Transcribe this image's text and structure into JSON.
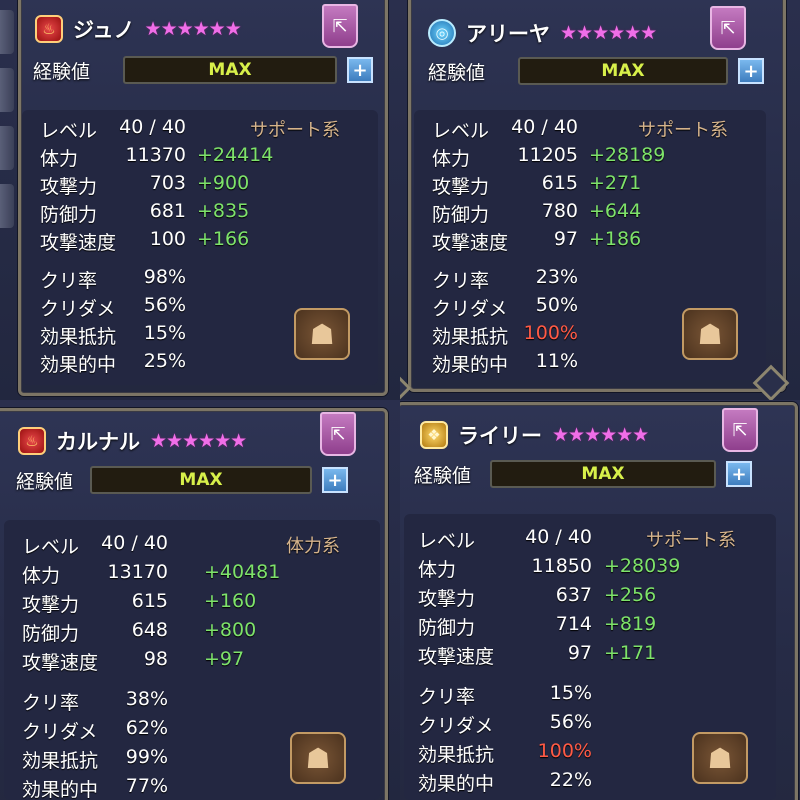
{
  "panels": [
    {
      "name": "ジュノ",
      "element": "fire",
      "element_icon": "flame",
      "stars": "★★★★★★",
      "exp_label": "経験値",
      "exp_value": "MAX",
      "category": "サポート系",
      "stats": [
        {
          "label": "レベル",
          "value": "40 / 40",
          "bonus": ""
        },
        {
          "label": "体力",
          "value": "11370",
          "bonus": "+24414"
        },
        {
          "label": "攻撃力",
          "value": "703",
          "bonus": "+900"
        },
        {
          "label": "防御力",
          "value": "681",
          "bonus": "+835"
        },
        {
          "label": "攻撃速度",
          "value": "100",
          "bonus": "+166"
        },
        {
          "label": "クリ率",
          "value": "98%",
          "bonus": ""
        },
        {
          "label": "クリダメ",
          "value": "56%",
          "bonus": ""
        },
        {
          "label": "効果抵抗",
          "value": "15%",
          "bonus": ""
        },
        {
          "label": "効果的中",
          "value": "25%",
          "bonus": ""
        }
      ]
    },
    {
      "name": "アリーヤ",
      "element": "water",
      "element_icon": "swirl",
      "stars": "★★★★★★",
      "exp_label": "経験値",
      "exp_value": "MAX",
      "category": "サポート系",
      "stats": [
        {
          "label": "レベル",
          "value": "40 / 40",
          "bonus": ""
        },
        {
          "label": "体力",
          "value": "11205",
          "bonus": "+28189"
        },
        {
          "label": "攻撃力",
          "value": "615",
          "bonus": "+271"
        },
        {
          "label": "防御力",
          "value": "780",
          "bonus": "+644"
        },
        {
          "label": "攻撃速度",
          "value": "97",
          "bonus": "+186"
        },
        {
          "label": "クリ率",
          "value": "23%",
          "bonus": ""
        },
        {
          "label": "クリダメ",
          "value": "50%",
          "bonus": ""
        },
        {
          "label": "効果抵抗",
          "value": "100%",
          "bonus": "",
          "highlight": "#ff5a45"
        },
        {
          "label": "効果的中",
          "value": "11%",
          "bonus": ""
        }
      ]
    },
    {
      "name": "カルナル",
      "element": "fire",
      "element_icon": "flame",
      "stars": "★★★★★★",
      "exp_label": "経験値",
      "exp_value": "MAX",
      "category": "体力系",
      "stats": [
        {
          "label": "レベル",
          "value": "40 / 40",
          "bonus": ""
        },
        {
          "label": "体力",
          "value": "13170",
          "bonus": "+40481"
        },
        {
          "label": "攻撃力",
          "value": "615",
          "bonus": "+160"
        },
        {
          "label": "防御力",
          "value": "648",
          "bonus": "+800"
        },
        {
          "label": "攻撃速度",
          "value": "98",
          "bonus": "+97"
        },
        {
          "label": "クリ率",
          "value": "38%",
          "bonus": ""
        },
        {
          "label": "クリダメ",
          "value": "62%",
          "bonus": ""
        },
        {
          "label": "効果抵抗",
          "value": "99%",
          "bonus": ""
        },
        {
          "label": "効果的中",
          "value": "77%",
          "bonus": ""
        }
      ]
    },
    {
      "name": "ライリー",
      "element": "wind",
      "element_icon": "gust",
      "stars": "★★★★★★",
      "exp_label": "経験値",
      "exp_value": "MAX",
      "category": "サポート系",
      "stats": [
        {
          "label": "レベル",
          "value": "40 / 40",
          "bonus": ""
        },
        {
          "label": "体力",
          "value": "11850",
          "bonus": "+28039"
        },
        {
          "label": "攻撃力",
          "value": "637",
          "bonus": "+256"
        },
        {
          "label": "防御力",
          "value": "714",
          "bonus": "+819"
        },
        {
          "label": "攻撃速度",
          "value": "97",
          "bonus": "+171"
        },
        {
          "label": "クリ率",
          "value": "15%",
          "bonus": ""
        },
        {
          "label": "クリダメ",
          "value": "56%",
          "bonus": ""
        },
        {
          "label": "効果抵抗",
          "value": "100%",
          "bonus": "",
          "highlight": "#ff5a45"
        },
        {
          "label": "効果的中",
          "value": "22%",
          "bonus": ""
        }
      ]
    }
  ],
  "icons": {
    "share": "share-icon",
    "plus": "plus-icon",
    "rune": "rune-mask-icon",
    "star": "star-icon"
  },
  "colors": {
    "bonus": "#7ee36a",
    "category": "#d6b48c",
    "exp_text": "#d8f04a",
    "star": "#f06ee8"
  }
}
